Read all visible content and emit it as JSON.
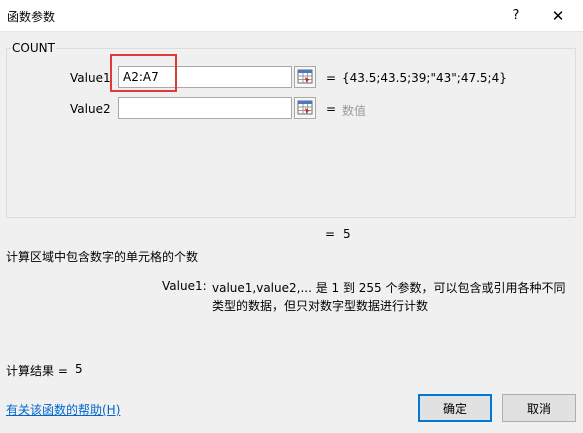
{
  "dialog": {
    "title": "函数参数",
    "help_glyph": "?",
    "close_glyph": "✕"
  },
  "function": {
    "name": "COUNT",
    "args": [
      {
        "label": "Value1",
        "value": "A2:A7",
        "placeholder": "",
        "eq": "=",
        "result": "{43.5;43.5;39;\"43\";47.5;4}",
        "result_is_hint": false
      },
      {
        "label": "Value2",
        "value": "",
        "placeholder": "",
        "eq": "=",
        "result": "数值",
        "result_is_hint": true
      }
    ],
    "result_eq": "=",
    "result_value": "5",
    "description": "计算区域中包含数字的单元格的个数",
    "param_name": "Value1:",
    "param_description": "value1,value2,... 是 1 到 255 个参数，可以包含或引用各种不同类型的数据，但只对数字型数据进行计数"
  },
  "footer": {
    "calc_label": "计算结果 =",
    "calc_value": "5",
    "help_link": "有关该函数的帮助(H)",
    "ok_label": "确定",
    "cancel_label": "取消"
  },
  "icons": {
    "close": "close-icon",
    "help": "help-icon",
    "range_select": "range-select-icon"
  },
  "colors": {
    "highlight": "#e03a3a",
    "link": "#0066cc",
    "default_button_border": "#0078d7"
  }
}
